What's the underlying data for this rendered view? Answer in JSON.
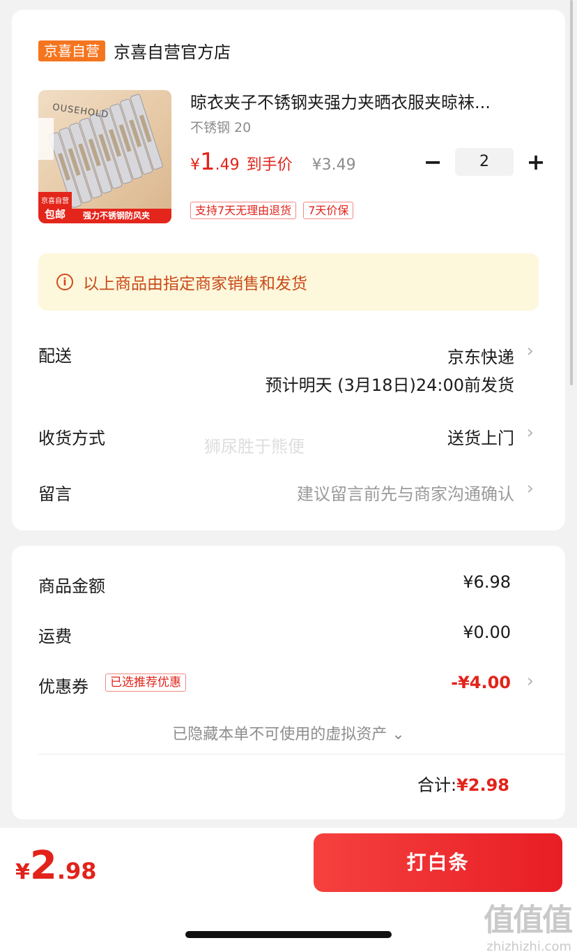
{
  "store": {
    "badge": "京喜自营",
    "name": "京喜自营官方店"
  },
  "product": {
    "image_icon": "clothespin-product-image",
    "image_overlay_text": "OUSEHOLD",
    "image_tag_small": "京喜自营",
    "image_tag_main": "包邮",
    "image_caption": "强力不锈钢防风夹",
    "title": "晾衣夹子不锈钢夹强力夹晒衣服夹晾袜...",
    "spec": "不锈钢 20",
    "price_symbol": "¥",
    "price_int": "1",
    "price_dec": ".49",
    "price_tag": "到手价",
    "original_price": "¥3.49",
    "quantity": "2",
    "minus": "−",
    "plus": "+",
    "tags": [
      "支持7天无理由退货",
      "7天价保"
    ]
  },
  "notice": {
    "icon": "i",
    "text": "以上商品由指定商家销售和发货"
  },
  "delivery": {
    "label": "配送",
    "value": "京东快递",
    "sub": "预计明天 (3月18日)24:00前发货"
  },
  "receive": {
    "label": "收货方式",
    "value": "送货上门"
  },
  "message": {
    "label": "留言",
    "placeholder": "建议留言前先与商家沟通确认"
  },
  "watermark": "狮尿胜于熊便",
  "summary": {
    "goods_label": "商品金额",
    "goods_value": "¥6.98",
    "shipping_label": "运费",
    "shipping_value": "¥0.00",
    "coupon_label": "优惠券",
    "coupon_tag": "已选推荐优惠",
    "coupon_value": "-¥4.00",
    "hidden_assets": "已隐藏本单不可使用的虚拟资产 ⌄",
    "total_label": "合计:",
    "total_value": "¥2.98"
  },
  "bottom": {
    "price_symbol": "¥",
    "price_int": "2",
    "price_dec": ".98",
    "pay_label": "打白条"
  },
  "corner_logo": {
    "big": "值值值",
    "small": "zhizhizhi.com"
  },
  "colors": {
    "accent_red": "#e2231a",
    "store_orange": "#f5751f",
    "notice_bg": "#fdf8dc"
  },
  "chevron": "›"
}
